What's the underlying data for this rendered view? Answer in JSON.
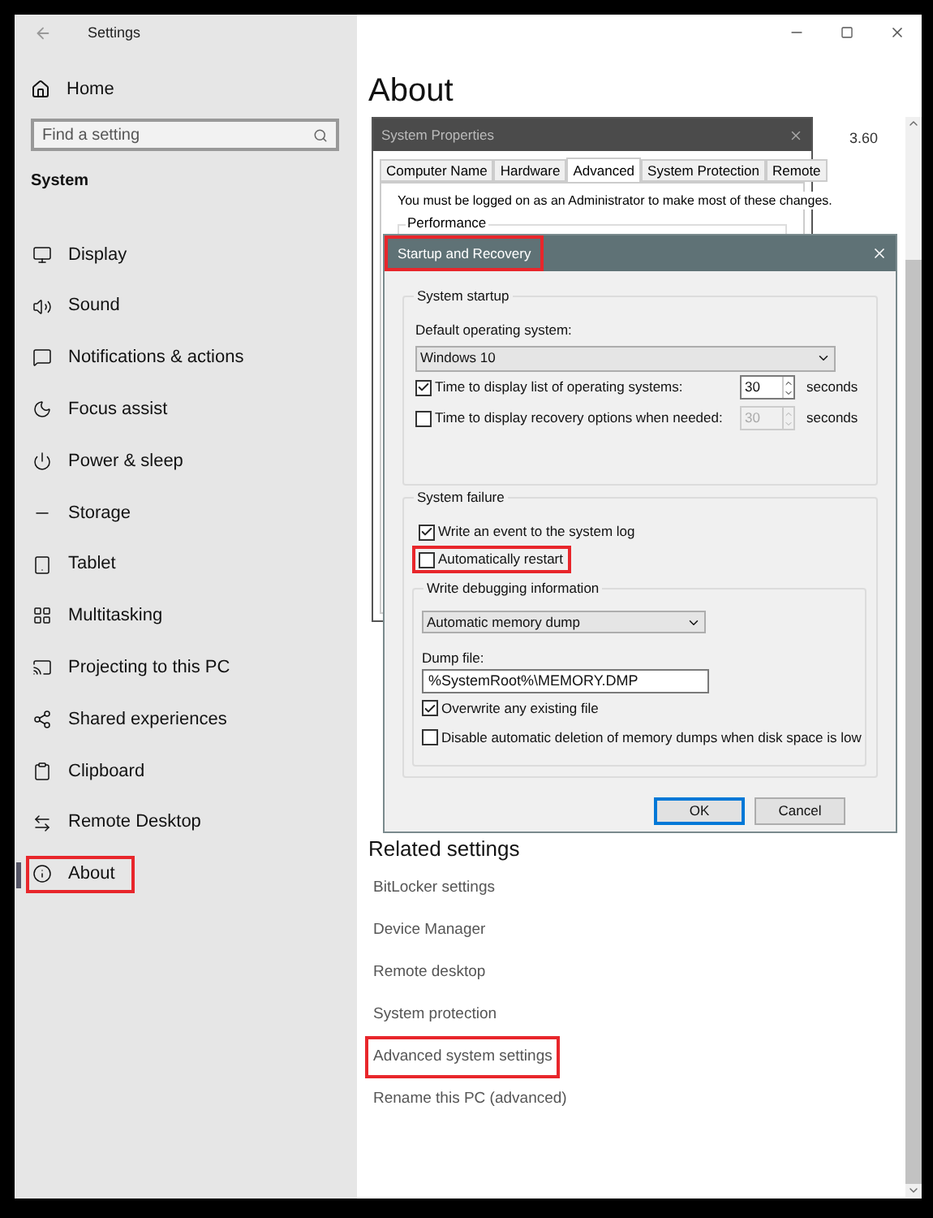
{
  "settings_window": {
    "title": "Settings",
    "sidebar": {
      "home": "Home",
      "search": {
        "placeholder": "Find a setting"
      },
      "section": "System",
      "items": [
        {
          "label": "Display",
          "selected": false,
          "highlighted": false
        },
        {
          "label": "Sound",
          "selected": false,
          "highlighted": false
        },
        {
          "label": "Notifications & actions",
          "selected": false,
          "highlighted": false
        },
        {
          "label": "Focus assist",
          "selected": false,
          "highlighted": false
        },
        {
          "label": "Power & sleep",
          "selected": false,
          "highlighted": false
        },
        {
          "label": "Storage",
          "selected": false,
          "highlighted": false
        },
        {
          "label": "Tablet",
          "selected": false,
          "highlighted": false
        },
        {
          "label": "Multitasking",
          "selected": false,
          "highlighted": false
        },
        {
          "label": "Projecting to this PC",
          "selected": false,
          "highlighted": false
        },
        {
          "label": "Shared experiences",
          "selected": false,
          "highlighted": false
        },
        {
          "label": "Clipboard",
          "selected": false,
          "highlighted": false
        },
        {
          "label": "Remote Desktop",
          "selected": false,
          "highlighted": false
        },
        {
          "label": "About",
          "selected": true,
          "highlighted": true
        }
      ]
    },
    "content": {
      "title": "About",
      "partial_value": "3.60",
      "related": {
        "heading": "Related settings",
        "links": [
          {
            "label": "BitLocker settings",
            "highlighted": false
          },
          {
            "label": "Device Manager",
            "highlighted": false
          },
          {
            "label": "Remote desktop",
            "highlighted": false
          },
          {
            "label": "System protection",
            "highlighted": false
          },
          {
            "label": "Advanced system settings",
            "highlighted": true
          },
          {
            "label": "Rename this PC (advanced)",
            "highlighted": false
          }
        ]
      }
    }
  },
  "system_properties": {
    "title": "System Properties",
    "tabs": [
      {
        "label": "Computer Name",
        "selected": false
      },
      {
        "label": "Hardware",
        "selected": false
      },
      {
        "label": "Advanced",
        "selected": true
      },
      {
        "label": "System Protection",
        "selected": false
      },
      {
        "label": "Remote",
        "selected": false
      }
    ],
    "notice": "You must be logged on as an Administrator to make most of these changes.",
    "group_label": "Performance"
  },
  "startup_recovery": {
    "title": "Startup and Recovery",
    "highlighted": true,
    "startup": {
      "label": "System startup",
      "default_os_label": "Default operating system:",
      "default_os": "Windows 10",
      "options": [
        {
          "label": "Time to display list of operating systems:",
          "checked": true,
          "value": "30",
          "unit": "seconds",
          "disabled": false
        },
        {
          "label": "Time to display recovery options when needed:",
          "checked": false,
          "value": "30",
          "unit": "seconds",
          "disabled": true
        }
      ]
    },
    "failure": {
      "label": "System failure",
      "options": [
        {
          "label": "Write an event to the system log",
          "checked": true,
          "highlighted": false
        },
        {
          "label": "Automatically restart",
          "checked": false,
          "highlighted": true
        }
      ],
      "debug": {
        "label": "Write debugging information",
        "type": "Automatic memory dump",
        "dump_file_label": "Dump file:",
        "dump_file": "%SystemRoot%\\MEMORY.DMP",
        "options": [
          {
            "label": "Overwrite any existing file",
            "checked": true
          },
          {
            "label": "Disable automatic deletion of memory dumps when disk space is low",
            "checked": false
          }
        ]
      }
    },
    "buttons": [
      {
        "label": "OK",
        "default": true
      },
      {
        "label": "Cancel",
        "default": false
      }
    ]
  }
}
